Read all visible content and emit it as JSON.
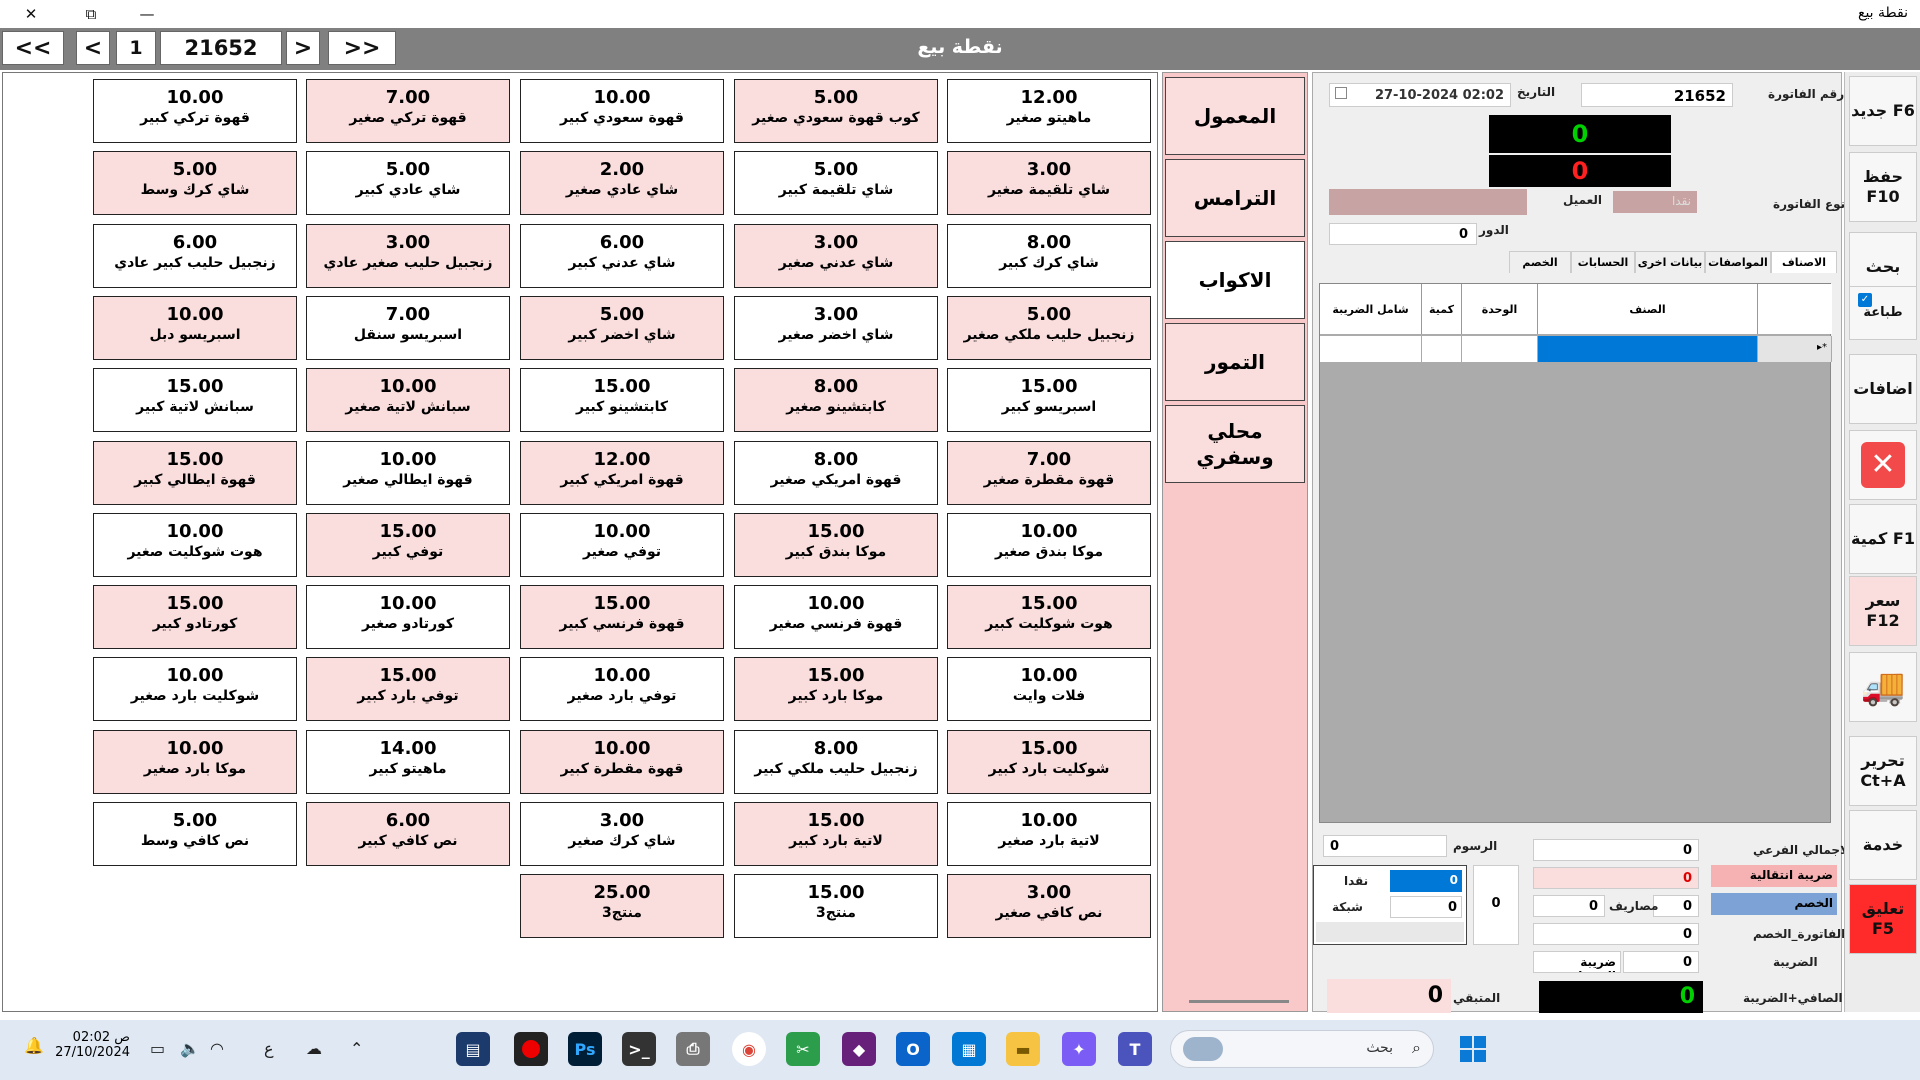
{
  "window": {
    "title": "نقطة بيع",
    "close_icon": "✕",
    "restore_icon": "⧉",
    "minimize_icon": "—"
  },
  "header": {
    "title": "نقطة بيع",
    "nav_first": "<<",
    "nav_prev": "<",
    "page_number": "1",
    "invoice_number": "21652",
    "nav_next": ">",
    "nav_last": ">>"
  },
  "products": [
    {
      "price": "10.00",
      "name": "قهوة تركي كبير",
      "tone": "w"
    },
    {
      "price": "7.00",
      "name": "قهوة تركي صغير",
      "tone": "p"
    },
    {
      "price": "10.00",
      "name": "قهوة سعودي كبير",
      "tone": "w"
    },
    {
      "price": "5.00",
      "name": "كوب قهوة سعودي صغير",
      "tone": "p"
    },
    {
      "price": "12.00",
      "name": "ماهيتو صغير",
      "tone": "w"
    },
    {
      "price": "5.00",
      "name": "شاي كرك وسط",
      "tone": "p"
    },
    {
      "price": "5.00",
      "name": "شاي عادي كبير",
      "tone": "w"
    },
    {
      "price": "2.00",
      "name": "شاي عادي صغير",
      "tone": "p"
    },
    {
      "price": "5.00",
      "name": "شاي تلقيمة كبير",
      "tone": "w"
    },
    {
      "price": "3.00",
      "name": "شاي تلقيمة صغير",
      "tone": "p"
    },
    {
      "price": "6.00",
      "name": "زنجبيل حليب كبير عادي",
      "tone": "w"
    },
    {
      "price": "3.00",
      "name": "زنجبيل حليب صغير عادي",
      "tone": "p"
    },
    {
      "price": "6.00",
      "name": "شاي عدني كبير",
      "tone": "w"
    },
    {
      "price": "3.00",
      "name": "شاي عدني صغير",
      "tone": "p"
    },
    {
      "price": "8.00",
      "name": "شاي كرك كبير",
      "tone": "w"
    },
    {
      "price": "10.00",
      "name": "اسبريسو دبل",
      "tone": "p"
    },
    {
      "price": "7.00",
      "name": "اسبريسو سنقل",
      "tone": "w"
    },
    {
      "price": "5.00",
      "name": "شاي اخضر كبير",
      "tone": "p"
    },
    {
      "price": "3.00",
      "name": "شاي اخضر صغير",
      "tone": "w"
    },
    {
      "price": "5.00",
      "name": "زنجبيل حليب ملكي صغير",
      "tone": "p"
    },
    {
      "price": "15.00",
      "name": "سبانش لاتية كبير",
      "tone": "w"
    },
    {
      "price": "10.00",
      "name": "سبانش لاتية صغير",
      "tone": "p"
    },
    {
      "price": "15.00",
      "name": "كابتشينو كبير",
      "tone": "w"
    },
    {
      "price": "8.00",
      "name": "كابتشينو صغير",
      "tone": "p"
    },
    {
      "price": "15.00",
      "name": "اسبريسو كبير",
      "tone": "w"
    },
    {
      "price": "15.00",
      "name": "قهوة ايطالي كبير",
      "tone": "p"
    },
    {
      "price": "10.00",
      "name": "قهوة ايطالي صغير",
      "tone": "w"
    },
    {
      "price": "12.00",
      "name": "قهوة امريكي كبير",
      "tone": "p"
    },
    {
      "price": "8.00",
      "name": "قهوة امريكي صغير",
      "tone": "w"
    },
    {
      "price": "7.00",
      "name": "قهوة مقطرة صغير",
      "tone": "p"
    },
    {
      "price": "10.00",
      "name": "هوت شوكليت صغير",
      "tone": "w"
    },
    {
      "price": "15.00",
      "name": "توفي كبير",
      "tone": "p"
    },
    {
      "price": "10.00",
      "name": "توفي صغير",
      "tone": "w"
    },
    {
      "price": "15.00",
      "name": "موكا بندق كبير",
      "tone": "p"
    },
    {
      "price": "10.00",
      "name": "موكا بندق صغير",
      "tone": "w"
    },
    {
      "price": "15.00",
      "name": "كورتادو كبير",
      "tone": "p"
    },
    {
      "price": "10.00",
      "name": "كورتادو صغير",
      "tone": "w"
    },
    {
      "price": "15.00",
      "name": "قهوة فرنسي كبير",
      "tone": "p"
    },
    {
      "price": "10.00",
      "name": "قهوة فرنسي صغير",
      "tone": "w"
    },
    {
      "price": "15.00",
      "name": "هوت شوكليت كبير",
      "tone": "p"
    },
    {
      "price": "10.00",
      "name": "شوكليت بارد صغير",
      "tone": "w"
    },
    {
      "price": "15.00",
      "name": "توفي بارد كبير",
      "tone": "p"
    },
    {
      "price": "10.00",
      "name": "توفي بارد صغير",
      "tone": "w"
    },
    {
      "price": "15.00",
      "name": "موكا بارد كبير",
      "tone": "p"
    },
    {
      "price": "10.00",
      "name": "فلات وايت",
      "tone": "w"
    },
    {
      "price": "10.00",
      "name": "موكا بارد صغير",
      "tone": "p"
    },
    {
      "price": "14.00",
      "name": "ماهيتو كبير",
      "tone": "w"
    },
    {
      "price": "10.00",
      "name": "قهوة مقطرة كبير",
      "tone": "p"
    },
    {
      "price": "8.00",
      "name": "زنجبيل حليب ملكي كبير",
      "tone": "w"
    },
    {
      "price": "15.00",
      "name": "شوكليت بارد كبير",
      "tone": "p"
    },
    {
      "price": "5.00",
      "name": "نص كافي وسط",
      "tone": "w"
    },
    {
      "price": "6.00",
      "name": "نص كافي كبير",
      "tone": "p"
    },
    {
      "price": "3.00",
      "name": "شاي كرك صغير",
      "tone": "w"
    },
    {
      "price": "15.00",
      "name": "لاتية بارد كبير",
      "tone": "p"
    },
    {
      "price": "10.00",
      "name": "لاتية بارد صغير",
      "tone": "w"
    },
    {
      "price": "25.00",
      "name": "منتج3",
      "tone": "p"
    },
    {
      "price": "15.00",
      "name": "منتج3",
      "tone": "w"
    },
    {
      "price": "3.00",
      "name": "نص كافي صغير",
      "tone": "p"
    }
  ],
  "categories": [
    {
      "label": "المعمول",
      "tone": "p"
    },
    {
      "label": "الترامس",
      "tone": "p"
    },
    {
      "label": "الاكواب",
      "tone": "w"
    },
    {
      "label": "التمور",
      "tone": "p"
    },
    {
      "label": "محلي وسفري",
      "tone": "p"
    }
  ],
  "invoice": {
    "invoice_no_label": "رقم الفاتورة",
    "invoice_no_value": "21652",
    "date_label": "التاريخ",
    "date_value": "27-10-2024  02:02",
    "display_top": "0",
    "display_bottom": "0",
    "invoice_type_label": "نوع الفاتورة",
    "invoice_type_value": "نقدا",
    "customer_label": "العميل",
    "turn_label": "الدور",
    "turn_value": "0",
    "tabs": [
      "الاصناف",
      "المواصفات",
      "بيانات اخرى",
      "الحسابات",
      "الخصم"
    ],
    "grid_headers": [
      "الصنف",
      "الوحدة",
      "كمية",
      "شامل الضريبة"
    ],
    "row_marker": "▸*",
    "totals": {
      "subtotal_label": "الاجمالي الفرعي",
      "subtotal_value": "0",
      "transition_tax_label": "ضريبة انتقالية",
      "transition_tax_value": "0",
      "discount_label": "الخصم",
      "expenses_label": "مصاريف",
      "expenses_value": "0",
      "expenses_pct": "0",
      "after_discount_label": "الفاتورة_الخصم",
      "after_discount_value": "0",
      "tax_label": "الضريبة",
      "tax_value": "0",
      "sales_tax_label": "ضريبة المبيعات",
      "net_label": "الصافي+الضريبة",
      "net_value": "0",
      "fees_label": "الرسوم",
      "fees_value": "0",
      "cash_label": "نقدا",
      "cash_value": "0",
      "network_label": "شبكة",
      "network_value": "0",
      "payment_total": "0",
      "remaining_label": "المتبقي",
      "remaining_value": "0"
    }
  },
  "toolbar": {
    "new": "جديد F6",
    "save": "حفظ F10",
    "search": "بحث",
    "print": "طباعة",
    "additions": "اضافات",
    "delete_icon": "delete-icon",
    "quantity": "كمية F1",
    "price": "سعر F12",
    "delivery_icon": "truck-icon",
    "edit": "تحرير Ct+A",
    "service": "خدمة",
    "suspend": "تعليق F5"
  },
  "taskbar": {
    "time": "02:02 ص",
    "date": "27/10/2024",
    "search_placeholder": "بحث",
    "lang": "ع"
  },
  "colors": {
    "header": "#808080",
    "pink": "#fadddd",
    "category_bg": "#f9c8c8",
    "accent_blue": "#0078d7",
    "green_display": "#00d000",
    "red_display": "#ff2020"
  }
}
